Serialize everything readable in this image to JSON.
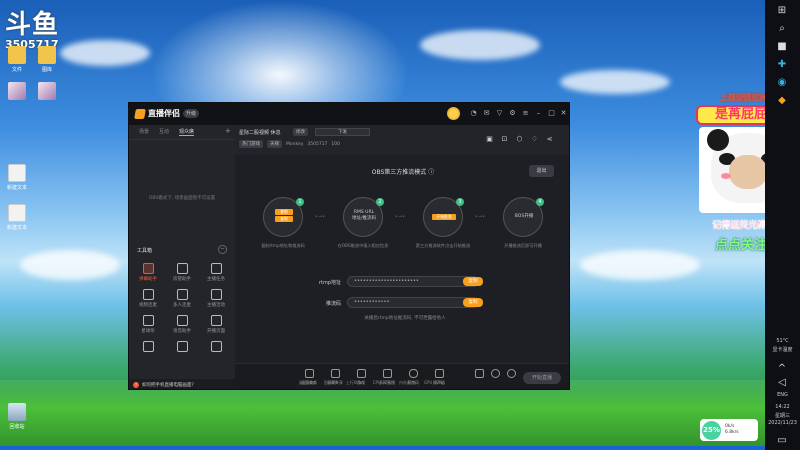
{
  "watermark": {
    "logo": "斗鱼",
    "room_id": "3505717"
  },
  "desktop": {
    "icons": [
      {
        "label": "文件"
      },
      {
        "label": "图库"
      },
      {
        "label": ""
      },
      {
        "label": ""
      },
      {
        "label": "新建文本"
      },
      {
        "label": "新建文本"
      },
      {
        "label": "回收站"
      }
    ]
  },
  "app": {
    "name": "直播伴侣",
    "version": "升级",
    "left_tabs": [
      "场景",
      "互动",
      "观众席"
    ],
    "left_hint": "OBS模式下, 场景画面暂不可设置",
    "tools_header": "工具箱",
    "tools": [
      {
        "label": "弹幕助手",
        "hot": true
      },
      {
        "label": "房管助手",
        "hot": false
      },
      {
        "label": "主播任务",
        "hot": false
      },
      {
        "label": "视频连麦",
        "hot": false
      },
      {
        "label": "多人连麦",
        "hot": false
      },
      {
        "label": "主播活动",
        "hot": false
      },
      {
        "label": "星球杂",
        "hot": false
      },
      {
        "label": "语音助手",
        "hot": false
      },
      {
        "label": "开播页面",
        "hot": false
      },
      {
        "label": "",
        "hot": false
      },
      {
        "label": "",
        "hot": false
      },
      {
        "label": "",
        "hot": false
      }
    ],
    "notice": "如何把手机直播电脑画面?",
    "room": {
      "title": "星际二股视频 休息",
      "edit": "修改",
      "category": "下发",
      "tags": [
        "热门游戏",
        "天梯"
      ],
      "streamer": "Monkey",
      "room_no": "3505717",
      "fans": "100"
    },
    "mode_title": "OBS第三方推流模式",
    "exit_label": "退出",
    "steps": [
      {
        "num": "1",
        "lines": [
          "复制",
          "复制"
        ],
        "caption": "复制rtmp地址和推流码"
      },
      {
        "num": "2",
        "lines": [
          "RMS URL",
          "地址/推流码"
        ],
        "caption": "在OBS推流中填入相应信息"
      },
      {
        "num": "3",
        "lines": [
          "开始推流",
          ""
        ],
        "caption": "第三方推流软件点击开始推流"
      },
      {
        "num": "4",
        "lines": [
          "BOS开播",
          ""
        ],
        "caption": "开播推流后即可开播"
      }
    ],
    "rtmp_label": "rtmp地址",
    "rtmp_value": "••••••••••••••••••••••",
    "key_label": "推流码",
    "key_value": "••••••••••••",
    "copy_label": "复制",
    "form_hint": "关播后rtmp地址推流码, 不可泄露给他人",
    "bottom_tools": [
      "画面美颜",
      "屏幕共享",
      "游戏",
      "多开直播",
      "麦克风",
      "扬声器"
    ],
    "start_label": "开始直播",
    "status": [
      "延迟0ms",
      "丢帧0%",
      "上行0kb/s",
      "CPU 12%",
      "内存41%",
      "GPU 10%"
    ]
  },
  "side_overlay": {
    "top_line": "上周最靓的妹妹",
    "badge": "是苒屁屁啊",
    "line1": "记得送荧光棒哦~",
    "line2": "点点关注吧"
  },
  "speed_widget": {
    "percent": "25%",
    "up": "0k/s",
    "down": "6.8k/s"
  },
  "taskbar": {
    "temp": "51°C",
    "gpu_temp": "显卡温度",
    "lang": "ENG",
    "time": "14:22",
    "weekday": "星期三",
    "date": "2022/11/23"
  }
}
